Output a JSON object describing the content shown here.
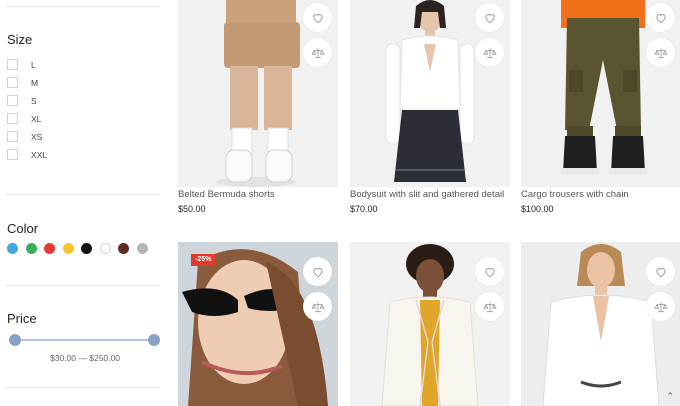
{
  "filters": {
    "size": {
      "title": "Size",
      "options": [
        "L",
        "M",
        "S",
        "XL",
        "XS",
        "XXL"
      ]
    },
    "color": {
      "title": "Color",
      "swatches": [
        {
          "name": "blue",
          "hex": "#3fa9e8"
        },
        {
          "name": "green",
          "hex": "#3fae5a"
        },
        {
          "name": "red",
          "hex": "#e53935"
        },
        {
          "name": "yellow",
          "hex": "#f7c52b"
        },
        {
          "name": "black",
          "hex": "#111111"
        },
        {
          "name": "white",
          "hex": "#ffffff"
        },
        {
          "name": "brown",
          "hex": "#5b2e23"
        },
        {
          "name": "gray",
          "hex": "#b5b5b5"
        }
      ]
    },
    "price": {
      "title": "Price",
      "range_text": "$30.00 — $250.00"
    }
  },
  "products": [
    {
      "name": "Belted Bermuda shorts",
      "price": "$50.00",
      "badge": ""
    },
    {
      "name": "Bodysuit with slit and gathered detail",
      "price": "$70.00",
      "badge": ""
    },
    {
      "name": "Cargo trousers with chain",
      "price": "$100.00",
      "badge": ""
    },
    {
      "name": "",
      "price": "",
      "badge": "-25%"
    },
    {
      "name": "",
      "price": "",
      "badge": ""
    },
    {
      "name": "",
      "price": "",
      "badge": ""
    }
  ]
}
